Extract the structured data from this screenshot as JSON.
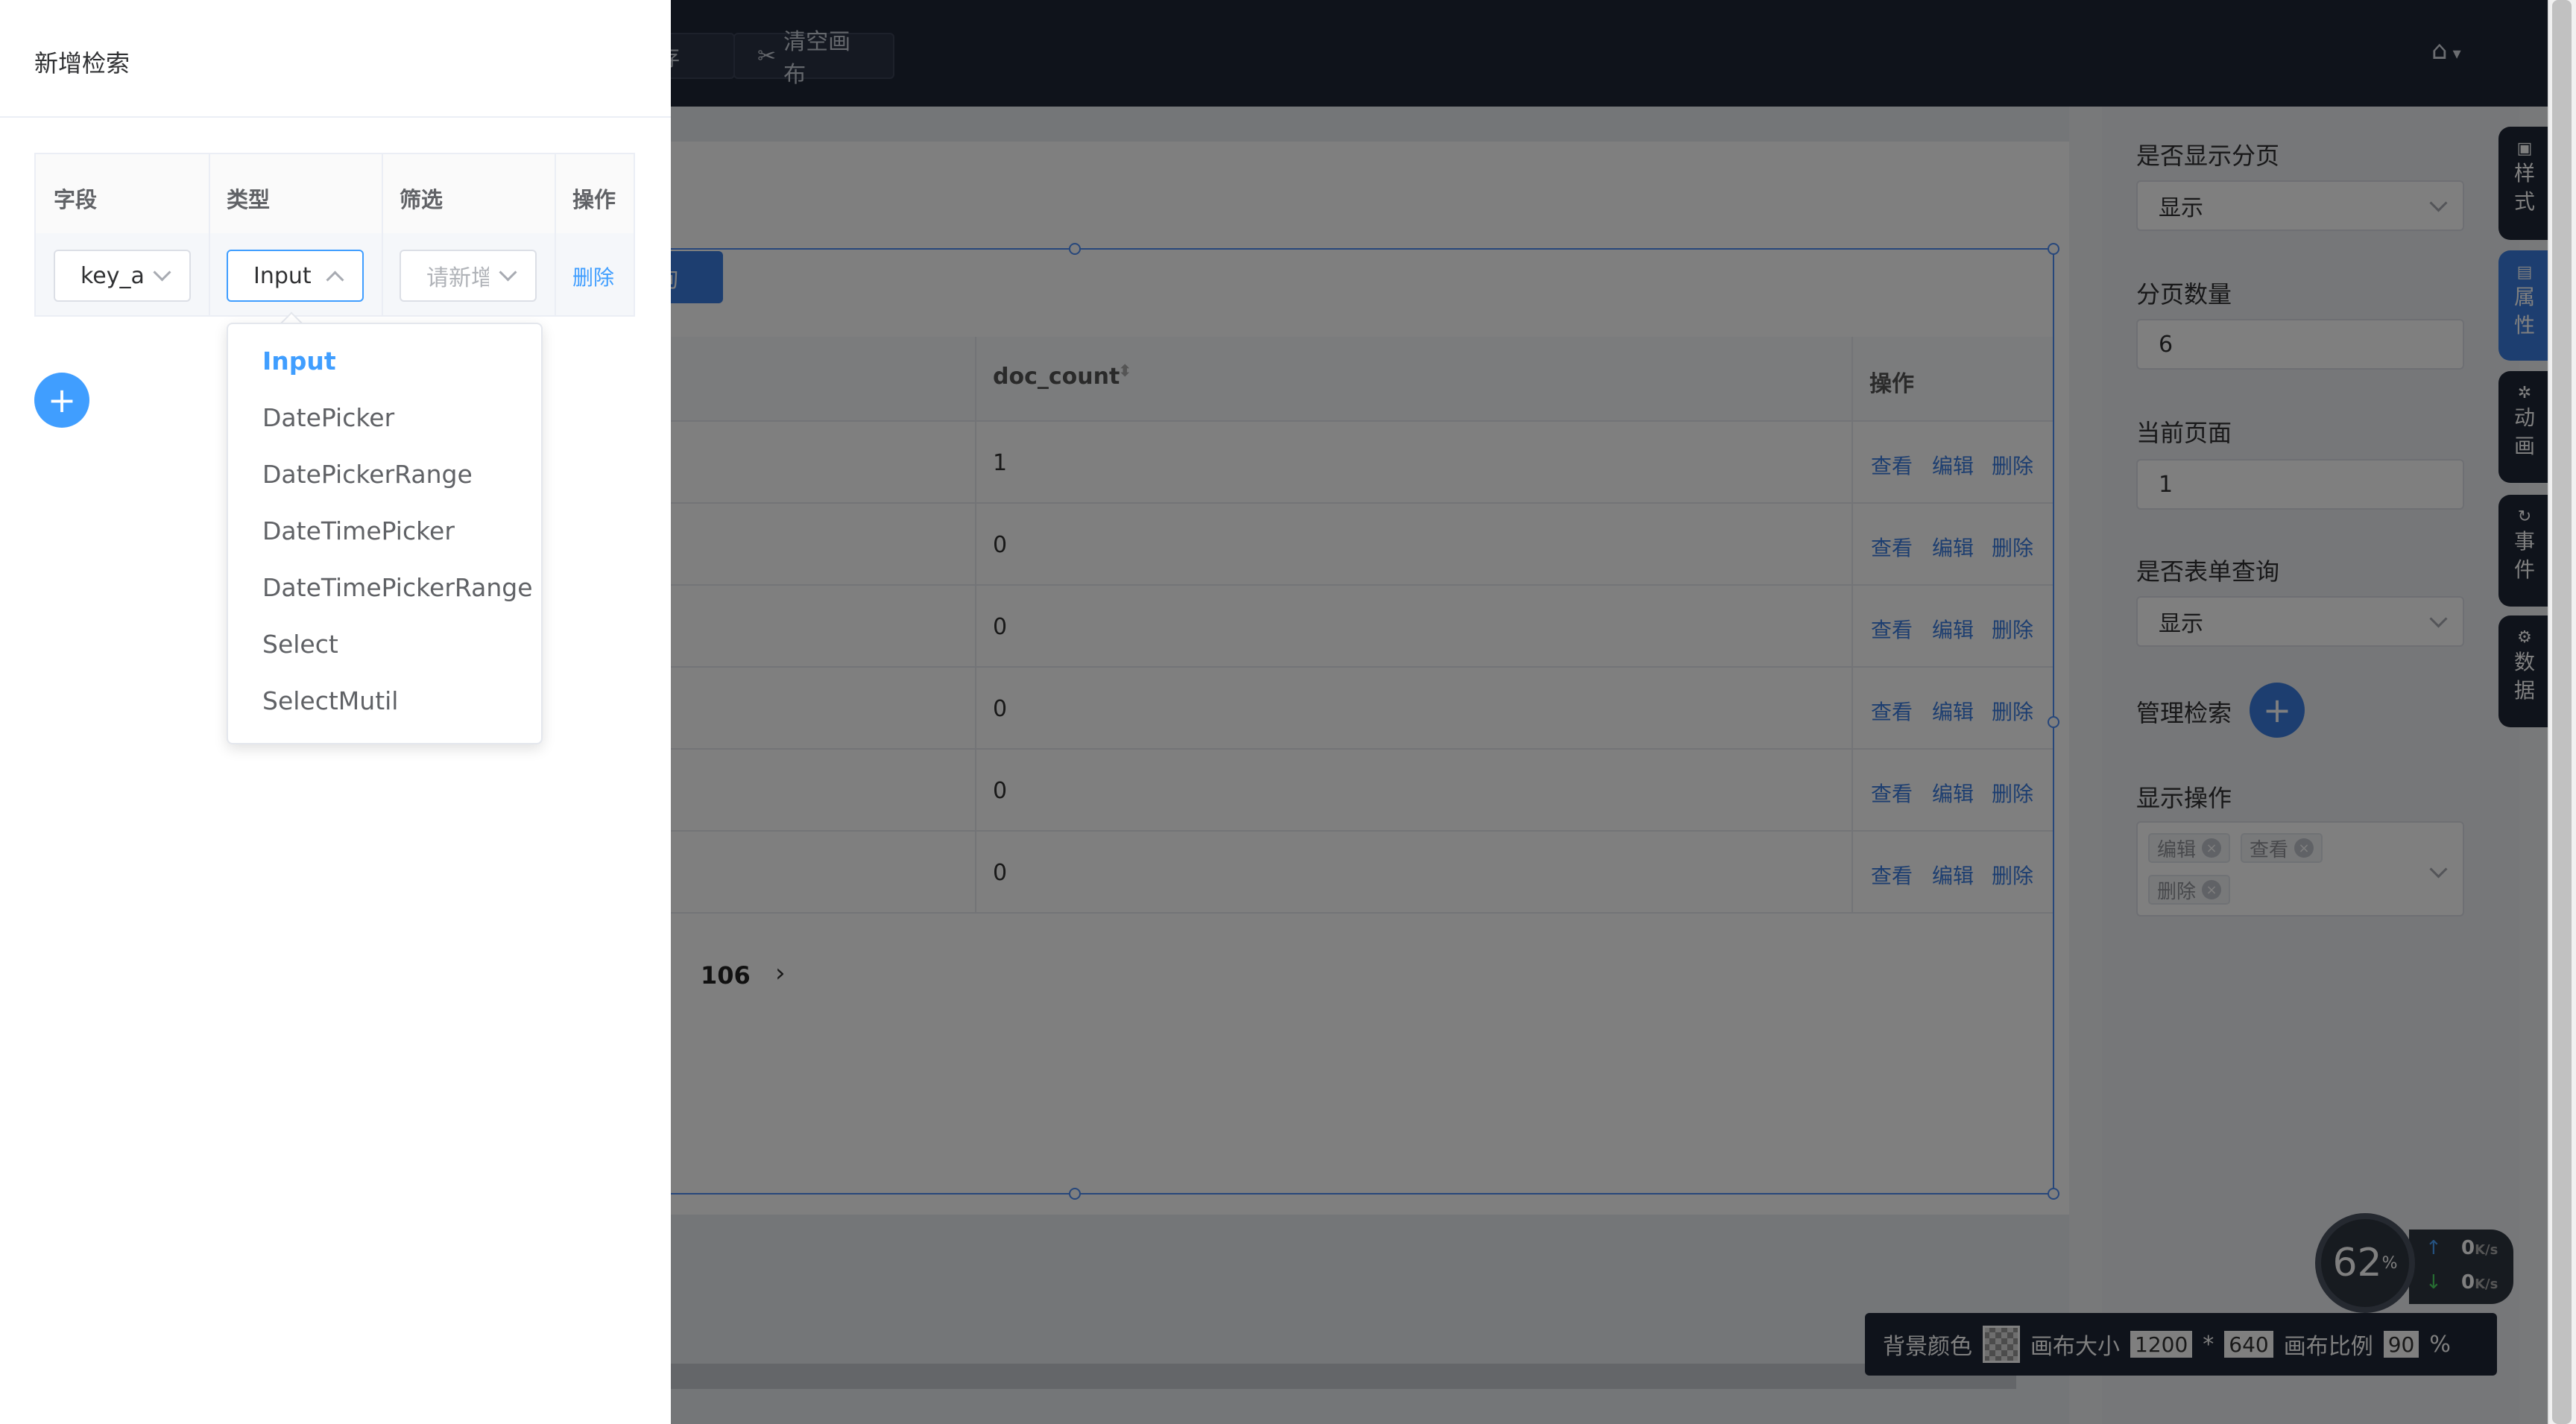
{
  "toolbar": {
    "save_label": "保存",
    "clear_label": "清空画布",
    "clear_icon": "scissors-icon",
    "home_icon": "home-icon"
  },
  "canvas": {
    "query_button": "询",
    "columns": {
      "doc_count": "doc_count",
      "actions": "操作"
    },
    "rows": [
      {
        "doc_count": "1",
        "actions": [
          "查看",
          "编辑",
          "删除"
        ]
      },
      {
        "doc_count": "0",
        "actions": [
          "查看",
          "编辑",
          "删除"
        ]
      },
      {
        "doc_count": "0",
        "actions": [
          "查看",
          "编辑",
          "删除"
        ]
      },
      {
        "doc_count": "0",
        "actions": [
          "查看",
          "编辑",
          "删除"
        ]
      },
      {
        "doc_count": "0",
        "actions": [
          "查看",
          "编辑",
          "删除"
        ]
      },
      {
        "doc_count": "0",
        "actions": [
          "查看",
          "编辑",
          "删除"
        ]
      }
    ],
    "pager": {
      "last_page": "106",
      "next": "›"
    }
  },
  "props": {
    "show_pagination_label": "是否显示分页",
    "show_pagination_value": "显示",
    "page_size_label": "分页数量",
    "page_size_value": "6",
    "current_page_label": "当前页面",
    "current_page_value": "1",
    "form_query_label": "是否表单查询",
    "form_query_value": "显示",
    "manage_search_label": "管理检索",
    "show_ops_label": "显示操作",
    "ops_tags": [
      "编辑",
      "查看",
      "删除"
    ]
  },
  "side_tabs": [
    {
      "label_1": "样",
      "label_2": "式",
      "icon": "style-icon"
    },
    {
      "label_1": "属",
      "label_2": "性",
      "icon": "property-icon"
    },
    {
      "label_1": "动",
      "label_2": "画",
      "icon": "animation-icon"
    },
    {
      "label_1": "事",
      "label_2": "件",
      "icon": "event-icon"
    },
    {
      "label_1": "数",
      "label_2": "据",
      "icon": "data-icon"
    }
  ],
  "net": {
    "percent": "62",
    "percent_unit": "%",
    "up": "0",
    "down": "0",
    "unit": "K/s"
  },
  "bottom_bar": {
    "bg_color_label": "背景颜色",
    "canvas_size_label": "画布大小",
    "width": "1200",
    "times": "*",
    "height": "640",
    "ratio_label": "画布比例",
    "ratio": "90",
    "percent": "%"
  },
  "drawer": {
    "title": "新增检索",
    "columns": {
      "field": "字段",
      "type": "类型",
      "filter": "筛选",
      "op": "操作"
    },
    "row": {
      "field_value": "key_a",
      "type_value": "Input",
      "filter_placeholder": "请新增",
      "delete_label": "删除"
    },
    "add_icon": "plus-icon"
  },
  "dropdown": {
    "options": [
      "Input",
      "DatePicker",
      "DatePickerRange",
      "DateTimePicker",
      "DateTimePickerRange",
      "Select",
      "SelectMutil"
    ],
    "selected": "Input"
  },
  "colors": {
    "accent": "#409eff",
    "header_bg": "#1f2636",
    "primary_btn": "#3a7de0"
  }
}
